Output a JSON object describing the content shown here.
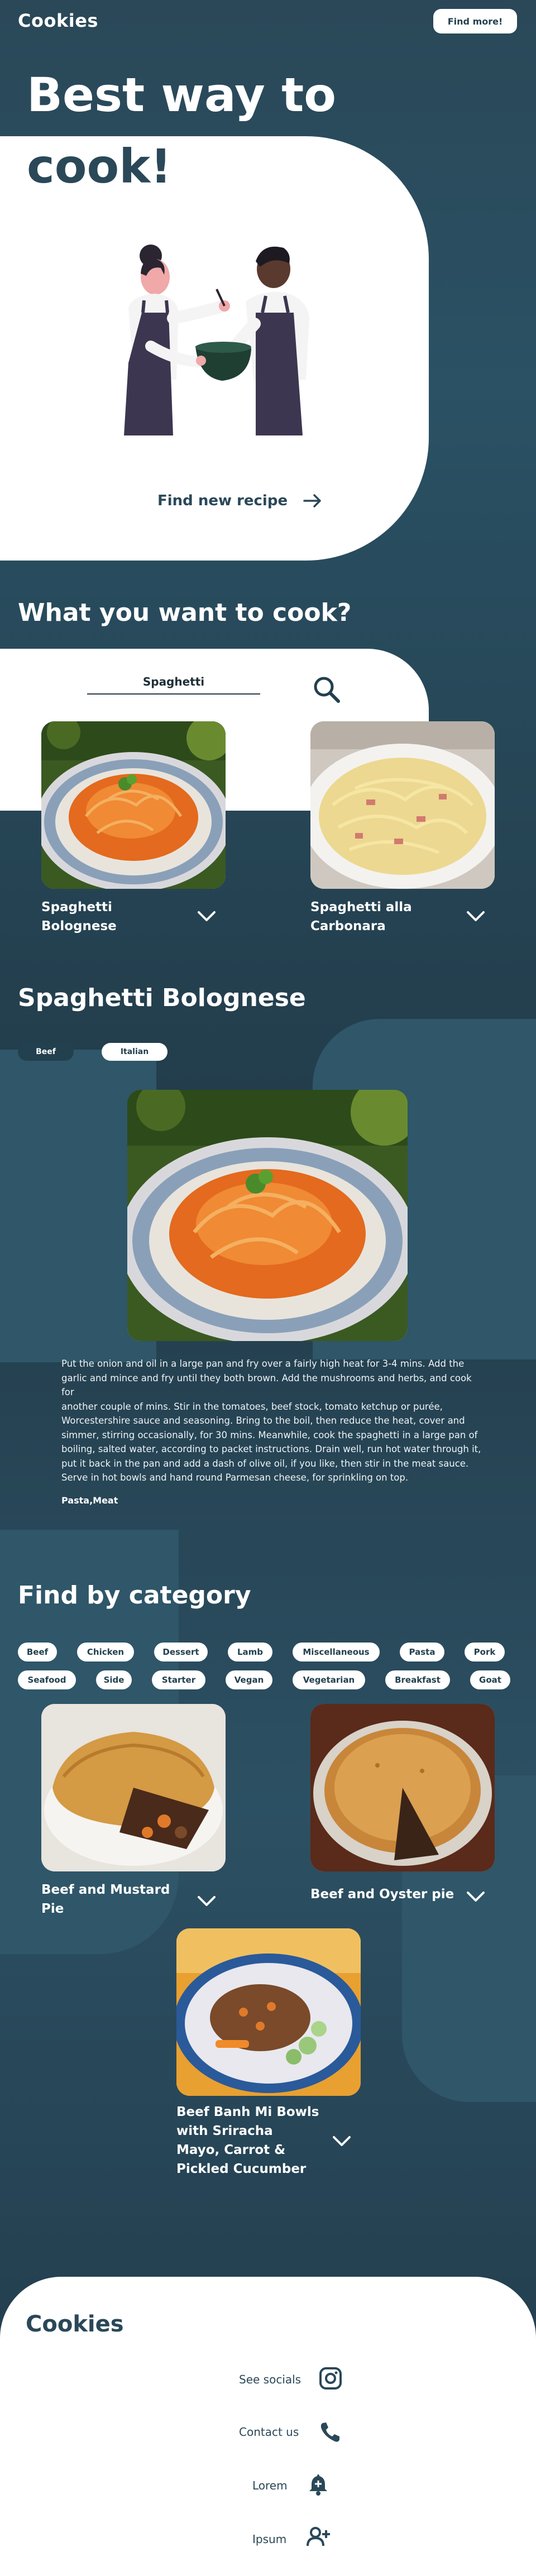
{
  "header": {
    "logo": "Cookies",
    "find_more": "Find more!"
  },
  "hero": {
    "line1": "Best way to",
    "line2": "cook!",
    "find_recipe": "Find new recipe"
  },
  "search": {
    "title": "What you want to cook?",
    "value": "Spaghetti"
  },
  "results": [
    {
      "name_line1": "Spaghetti",
      "name_line2": "Bolognese"
    },
    {
      "name_line1": "Spaghetti alla",
      "name_line2": "Carbonara"
    }
  ],
  "detail": {
    "title": "Spaghetti Bolognese",
    "tags": [
      "Beef",
      "Italian"
    ],
    "instructions": [
      "Put the onion and oil in a large pan and fry over a fairly high heat for 3-4 mins. Add the",
      "garlic and mince and fry until they both brown. Add the mushrooms and herbs, and cook for",
      "another couple of mins. Stir in the tomatoes, beef stock, tomato ketchup or purée,",
      "Worcestershire sauce and seasoning. Bring to the boil, then reduce the heat, cover and",
      "simmer, stirring occasionally, for 30 mins. Meanwhile, cook the spaghetti in a large pan of",
      "boiling, salted water, according to packet instructions. Drain well, run hot water through it,",
      "put it back in the pan and add a dash of olive oil, if you like, then stir in the meat sauce.",
      "Serve in hot bowls and hand round Parmesan cheese, for sprinkling on top."
    ],
    "meta_tags": "Pasta,Meat"
  },
  "categories": {
    "title": "Find by category",
    "row1": [
      "Beef",
      "Chicken",
      "Dessert",
      "Lamb",
      "Miscellaneous",
      "Pasta",
      "Pork"
    ],
    "row2": [
      "Seafood",
      "Side",
      "Starter",
      "Vegan",
      "Vegetarian",
      "Breakfast",
      "Goat"
    ],
    "results": [
      {
        "name_line1": "Beef and Mustard",
        "name_line2": "Pie"
      },
      {
        "name_line1": "Beef and Oyster pie",
        "name_line2": ""
      },
      {
        "name_line1": "Beef Banh Mi Bowls",
        "name_line2": "with Sriracha",
        "name_line3": "Mayo, Carrot &",
        "name_line4": "Pickled Cucumber"
      }
    ]
  },
  "footer": {
    "logo": "Cookies",
    "links": [
      "See socials",
      "Contact us",
      "Lorem",
      "Ipsum"
    ]
  },
  "colors": {
    "primary": "#2a4858",
    "secondary": "#2f5669",
    "card": "#ffffff"
  },
  "icons": [
    "arrow-right-icon",
    "search-icon",
    "chevron-down-icon",
    "instagram-icon",
    "phone-icon",
    "bell-icon",
    "add-user-icon"
  ]
}
